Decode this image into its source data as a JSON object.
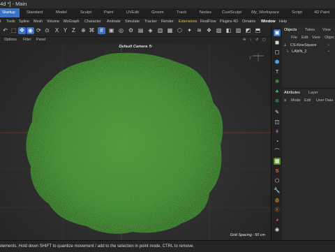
{
  "window": {
    "title": ":4d *] - Main"
  },
  "layouts": [
    "Startup",
    "Standard",
    "Model",
    "Sculpt",
    "Paint",
    "UVEdit",
    "Groom",
    "Track",
    "Nodes",
    "CustSculpt",
    "My_Workspace",
    "Script",
    "4D Paint"
  ],
  "menu": [
    "t",
    "Tools",
    "Spline",
    "Mesh",
    "Volume",
    "MoGraph",
    "Character",
    "Animate",
    "Simulate",
    "Tracker",
    "Render",
    "Extensions",
    "RealFlow",
    "Plugins 4D",
    "Ornatrix",
    "Window",
    "Help"
  ],
  "viewport_menu": [
    "Options",
    "Filter",
    "Panel"
  ],
  "viewport": {
    "camera_label": "Default Camera ↻",
    "grid_spacing": "Grid Spacing : 50 cm"
  },
  "objects_panel": {
    "tabs": [
      "Objects",
      "Takes",
      "View"
    ],
    "menu": [
      "File",
      "Edit",
      "View",
      "Objec"
    ],
    "items": [
      "CS-KineSquare",
      "LAWN_2"
    ]
  },
  "attributes_panel": {
    "tabs": [
      "Attributes",
      "Layer"
    ],
    "menu": [
      "Mode",
      "Edit",
      "User Data"
    ]
  },
  "status": {
    "text": "e elements. Hold down SHIFT to quantize movement / add to the selection in point mode, CTRL to remove."
  },
  "colors": {
    "accent": "#3a72c4",
    "grass": "#3f8a2c",
    "highlight_menu": "#e8c24a"
  }
}
